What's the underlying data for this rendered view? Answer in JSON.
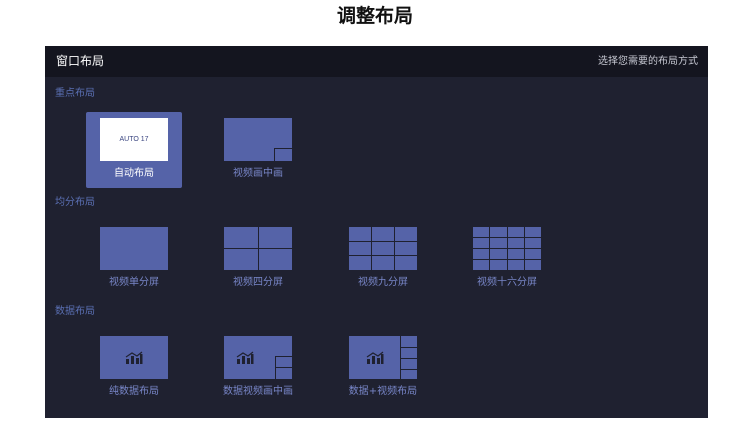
{
  "page_title": "调整布局",
  "panel": {
    "title": "窗口布局",
    "hint": "选择您需要的布局方式"
  },
  "sections": {
    "focus": {
      "label": "重点布局",
      "items": [
        {
          "label": "自动布局",
          "thumb_text": "AUTO 17",
          "selected": true
        },
        {
          "label": "视频画中画"
        }
      ]
    },
    "even": {
      "label": "均分布局",
      "items": [
        {
          "label": "视频单分屏"
        },
        {
          "label": "视频四分屏"
        },
        {
          "label": "视频九分屏"
        },
        {
          "label": "视频十六分屏"
        }
      ]
    },
    "data": {
      "label": "数据布局",
      "items": [
        {
          "label": "纯数据布局"
        },
        {
          "label": "数据视频画中画"
        },
        {
          "label": "数据+视频布局"
        }
      ]
    }
  },
  "icons": {
    "chart": "bar-line-chart-icon"
  },
  "colors": {
    "panel_bg": "#1f2130",
    "header_bg": "#14151f",
    "tile_blue": "#5563a8",
    "section_label": "#5a6fb2",
    "item_label": "#7886c8"
  }
}
